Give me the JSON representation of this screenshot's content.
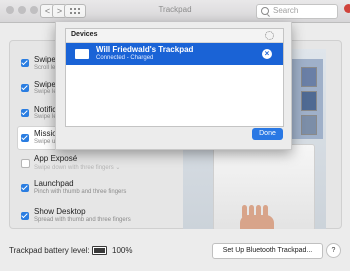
{
  "window": {
    "title": "Trackpad"
  },
  "toolbar": {
    "back": "<",
    "forward": ">",
    "search_placeholder": "Search"
  },
  "options": [
    {
      "label": "Swipe",
      "sub": "Scroll le",
      "checked": true
    },
    {
      "label": "Swipe",
      "sub": "Swipe le",
      "checked": true
    },
    {
      "label": "Notific",
      "sub": "Swipe le",
      "checked": true
    },
    {
      "label": "Mission",
      "sub": "Swipe u",
      "checked": true
    },
    {
      "label": "App Exposé",
      "sub": "Swipe down with three fingers ⌄",
      "checked": false
    },
    {
      "label": "Launchpad",
      "sub": "Pinch with thumb and three fingers",
      "checked": true
    },
    {
      "label": "Show Desktop",
      "sub": "Spread with thumb and three fingers",
      "checked": true
    }
  ],
  "bottom": {
    "battery_label": "Trackpad battery level:",
    "battery_percent": "100%",
    "battery_level": 1.0,
    "setup_button": "Set Up Bluetooth Trackpad...",
    "help_button": "?"
  },
  "devices_sheet": {
    "header": "Devices",
    "device": {
      "name": "Will Friedwald's Trackpad",
      "status": "Connected - Charged",
      "remove": "×"
    },
    "done": "Done"
  },
  "colors": {
    "accent": "#1a63d6",
    "checkbox": "#2a7de1"
  }
}
